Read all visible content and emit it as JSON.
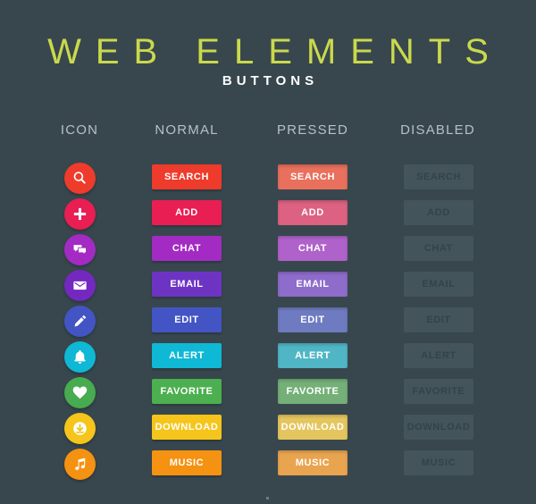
{
  "header": {
    "title": "WEB ELEMENTS",
    "subtitle": "BUTTONS",
    "title_color": "#cbd94b",
    "subtitle_color": "#ffffff"
  },
  "background_color": "#38474e",
  "columns": [
    {
      "label": "ICON"
    },
    {
      "label": "NORMAL"
    },
    {
      "label": "PRESSED"
    },
    {
      "label": "DISABLED"
    }
  ],
  "rows": [
    {
      "label": "SEARCH",
      "icon": "search-icon",
      "icon_color": "#ee3b2b",
      "normal_color": "#ee3b2b",
      "pressed_color": "#e8705c",
      "disabled_color": "#44545b",
      "disabled_text_color": "#34434a"
    },
    {
      "label": "ADD",
      "icon": "plus-icon",
      "icon_color": "#e91e52",
      "normal_color": "#e91e52",
      "pressed_color": "#dd6281",
      "disabled_color": "#44545b",
      "disabled_text_color": "#34434a"
    },
    {
      "label": "CHAT",
      "icon": "chat-icon",
      "icon_color": "#a32bc4",
      "normal_color": "#a32bc4",
      "pressed_color": "#b062cb",
      "disabled_color": "#44545b",
      "disabled_text_color": "#34434a"
    },
    {
      "label": "EMAIL",
      "icon": "email-icon",
      "icon_color": "#7428c0",
      "normal_color": "#6d34c4",
      "pressed_color": "#8e6ccb",
      "disabled_color": "#44545b",
      "disabled_text_color": "#34434a"
    },
    {
      "label": "EDIT",
      "icon": "pencil-icon",
      "icon_color": "#4355c4",
      "normal_color": "#4355c4",
      "pressed_color": "#6f7bc0",
      "disabled_color": "#44545b",
      "disabled_text_color": "#34434a"
    },
    {
      "label": "ALERT",
      "icon": "bell-icon",
      "icon_color": "#0fb8d4",
      "normal_color": "#0fb8d4",
      "pressed_color": "#50b6c6",
      "disabled_color": "#44545b",
      "disabled_text_color": "#34434a"
    },
    {
      "label": "FAVORITE",
      "icon": "heart-icon",
      "icon_color": "#47ab4f",
      "normal_color": "#4caf50",
      "pressed_color": "#74b078",
      "disabled_color": "#44545b",
      "disabled_text_color": "#34434a"
    },
    {
      "label": "DOWNLOAD",
      "icon": "download-icon",
      "icon_color": "#f5c51b",
      "normal_color": "#f5c51b",
      "pressed_color": "#e4c55e",
      "disabled_color": "#44545b",
      "disabled_text_color": "#34434a"
    },
    {
      "label": "MUSIC",
      "icon": "music-icon",
      "icon_color": "#f59211",
      "normal_color": "#f59211",
      "pressed_color": "#e9a44f",
      "disabled_color": "#44545b",
      "disabled_text_color": "#34434a"
    }
  ]
}
